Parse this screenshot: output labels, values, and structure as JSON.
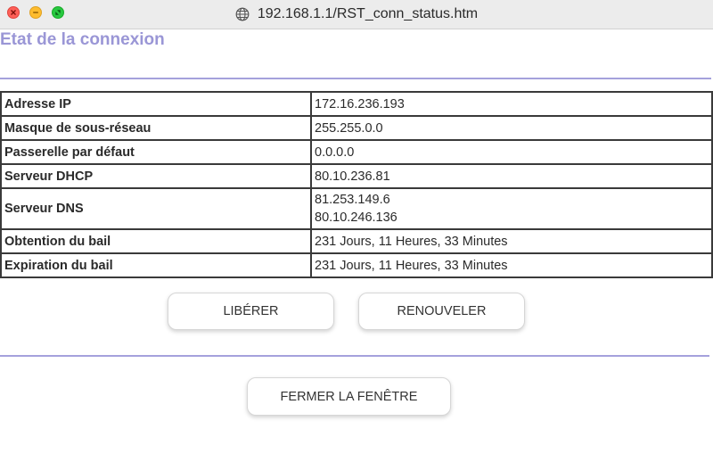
{
  "window": {
    "url": "192.168.1.1/RST_conn_status.htm",
    "icons": {
      "close": "close-icon",
      "minimize": "minimize-icon",
      "maximize": "maximize-icon",
      "site": "globe-icon"
    }
  },
  "page": {
    "title": "Etat de la connexion",
    "accent_color": "#9a96d6"
  },
  "status_table": {
    "rows": [
      {
        "label": "Adresse IP",
        "values": [
          "172.16.236.193"
        ]
      },
      {
        "label": "Masque de sous-réseau",
        "values": [
          "255.255.0.0"
        ]
      },
      {
        "label": "Passerelle par défaut",
        "values": [
          "0.0.0.0"
        ]
      },
      {
        "label": "Serveur DHCP",
        "values": [
          "80.10.236.81"
        ]
      },
      {
        "label": "Serveur DNS",
        "values": [
          "81.253.149.6",
          "80.10.246.136"
        ]
      },
      {
        "label": "Obtention du bail",
        "values": [
          "231 Jours, 11 Heures, 33 Minutes"
        ]
      },
      {
        "label": "Expiration du bail",
        "values": [
          "231 Jours, 11 Heures, 33 Minutes"
        ]
      }
    ]
  },
  "buttons": {
    "release": "LIBÉRER",
    "renew": "RENOUVELER",
    "close_window": "FERMER LA FENÊTRE"
  }
}
